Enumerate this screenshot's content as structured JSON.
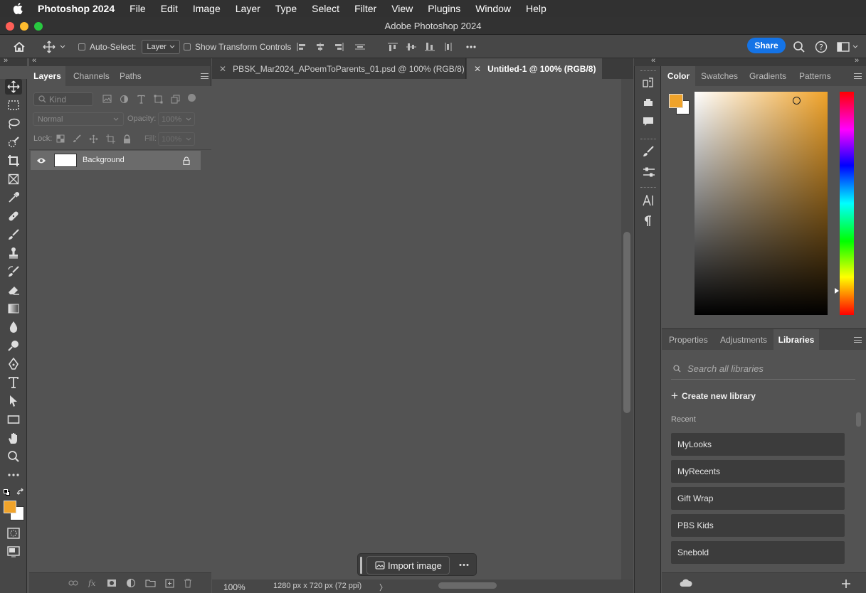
{
  "menubar": {
    "app_name": "Photoshop 2024",
    "items": [
      "File",
      "Edit",
      "Image",
      "Layer",
      "Type",
      "Select",
      "Filter",
      "View",
      "Plugins",
      "Window",
      "Help"
    ]
  },
  "window": {
    "title": "Adobe Photoshop 2024"
  },
  "options_bar": {
    "auto_select_label": "Auto-Select:",
    "auto_select_value": "Layer",
    "show_transform_label": "Show Transform Controls",
    "share_label": "Share"
  },
  "layers_panel": {
    "tabs": [
      "Layers",
      "Channels",
      "Paths"
    ],
    "active_tab": "Layers",
    "filter_kind": "Kind",
    "blend_mode": "Normal",
    "opacity_label": "Opacity:",
    "opacity_value": "100%",
    "lock_label": "Lock:",
    "fill_label": "Fill:",
    "fill_value": "100%",
    "layers": [
      {
        "name": "Background",
        "visible": true,
        "locked": true
      }
    ]
  },
  "documents": {
    "tabs": [
      {
        "label": "PBSK_Mar2024_APoemToParents_01.psd @ 100% (RGB/8)",
        "active": false
      },
      {
        "label": "Untitled-1 @ 100% (RGB/8)",
        "active": true
      }
    ]
  },
  "status": {
    "zoom": "100%",
    "doc_info": "1280 px x 720 px (72 ppi)",
    "arrow": "〉"
  },
  "contextual_bar": {
    "import_label": "Import image"
  },
  "color_panel": {
    "tabs": [
      "Color",
      "Swatches",
      "Gradients",
      "Patterns"
    ],
    "active_tab": "Color",
    "foreground": "#f0a32a",
    "background": "#ffffff"
  },
  "libraries_panel": {
    "tabs": [
      "Properties",
      "Adjustments",
      "Libraries"
    ],
    "active_tab": "Libraries",
    "search_placeholder": "Search all libraries",
    "create_label": "Create new library",
    "recent_label": "Recent",
    "libraries": [
      "MyLooks",
      "MyRecents",
      "Gift Wrap",
      "PBS Kids",
      "Snebold"
    ]
  },
  "colors": {
    "accent": "#1473e6",
    "ui_bg": "#535353",
    "panel_bg": "#474747"
  }
}
